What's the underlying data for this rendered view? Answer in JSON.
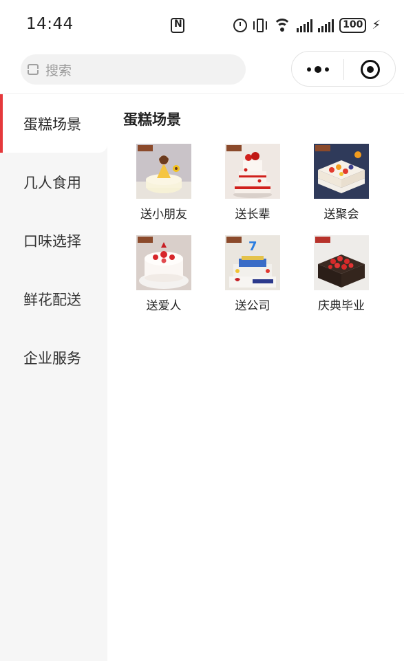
{
  "status_bar": {
    "time": "14:44",
    "battery": "100",
    "icons": [
      "nfc-icon",
      "alarm-icon",
      "vibrate-icon",
      "wifi-icon",
      "signal-icon",
      "signal-icon",
      "battery-icon",
      "charging-icon"
    ]
  },
  "search": {
    "placeholder": "搜索",
    "icon": "scan-icon"
  },
  "capsule": {
    "more_icon": "more-dots-icon",
    "close_icon": "miniprogram-close-icon"
  },
  "sidebar": {
    "items": [
      {
        "label": "蛋糕场景",
        "active": true
      },
      {
        "label": "几人食用",
        "active": false
      },
      {
        "label": "口味选择",
        "active": false
      },
      {
        "label": "鲜花配送",
        "active": false
      },
      {
        "label": "企业服务",
        "active": false
      }
    ],
    "active_color": "#e5383b"
  },
  "main": {
    "section_title": "蛋糕场景",
    "categories": [
      {
        "label": "送小朋友",
        "image": "princess-doll-cake"
      },
      {
        "label": "送长辈",
        "image": "three-tier-red-cake"
      },
      {
        "label": "送聚会",
        "image": "fruit-square-cake"
      },
      {
        "label": "送爱人",
        "image": "strawberry-round-cake"
      },
      {
        "label": "送公司",
        "image": "company-anniversary-cake"
      },
      {
        "label": "庆典毕业",
        "image": "chocolate-strawberry-cake"
      }
    ]
  }
}
